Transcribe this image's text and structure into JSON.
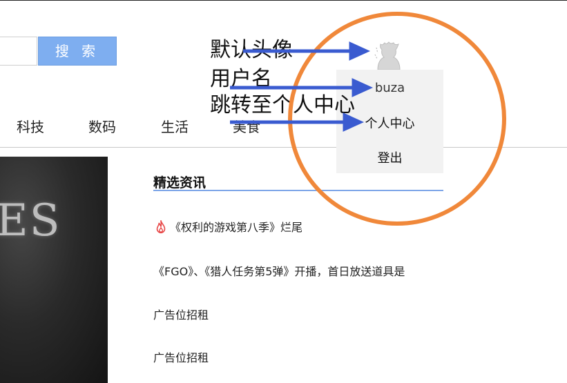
{
  "search": {
    "input_value": "",
    "button_label": "搜 索"
  },
  "nav": {
    "items": [
      "科技",
      "数码",
      "生活",
      "美食"
    ]
  },
  "news": {
    "title": "精选资讯",
    "items": [
      "《权利的游戏第八季》烂尾",
      "《FGO》、《猎人任务第5弹》开播，首日放送道具是",
      "广告位招租",
      "广告位招租"
    ],
    "hot_icon": "flame-icon"
  },
  "user_menu": {
    "avatar_icon": "default-avatar-icon",
    "username": "buza",
    "personal_center": "个人中心",
    "logout": "登出"
  },
  "annotations": {
    "avatar_label": "默认头像",
    "username_label": "用户名",
    "center_label": "跳转至个人中心"
  },
  "colors": {
    "search_button": "#7eaef0",
    "news_underline": "#7ea6e8",
    "dropdown_bg": "#f2f2f2",
    "annotation_arrow": "#3a5bd0",
    "annotation_circle": "#f0883a",
    "hot_icon": "#e84a4a"
  }
}
